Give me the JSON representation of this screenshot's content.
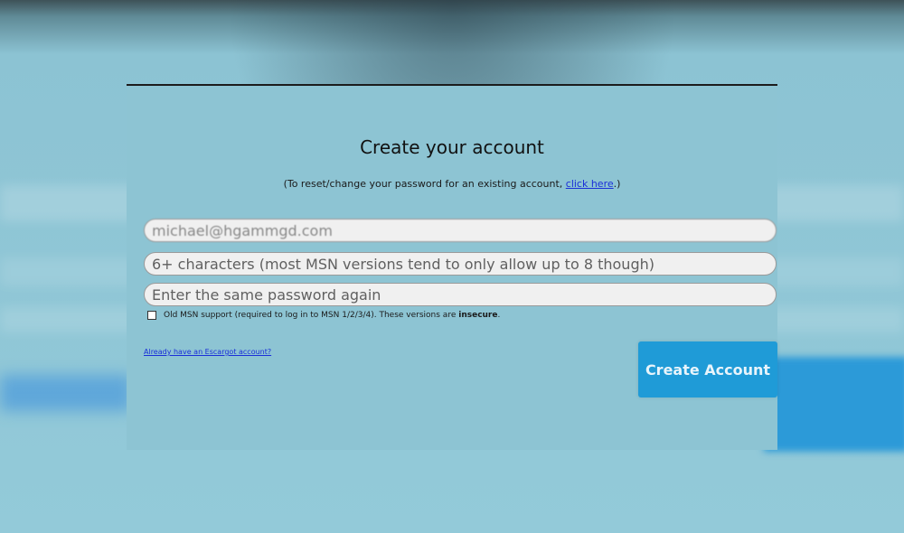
{
  "form": {
    "title": "Create your account",
    "reset_note_prefix": "(To reset/change your password for an existing account, ",
    "reset_link": "click here",
    "reset_note_suffix": ".)",
    "email_value": "michael@hgammgd.com",
    "password_placeholder": "6+ characters (most MSN versions tend to only allow up to 8 though)",
    "confirm_placeholder": "Enter the same password again",
    "old_msn_label_prefix": "Old MSN support (required to log in to MSN 1/2/3/4). These versions are ",
    "old_msn_label_bold": "insecure",
    "old_msn_label_suffix": ".",
    "old_msn_checked": false,
    "already_link": "Already have an Escargot account?",
    "submit_label": "Create Account"
  },
  "colors": {
    "panel_bg": "#8dc4d3",
    "button_bg": "#1f9bd7",
    "link": "#1a2fd8"
  }
}
